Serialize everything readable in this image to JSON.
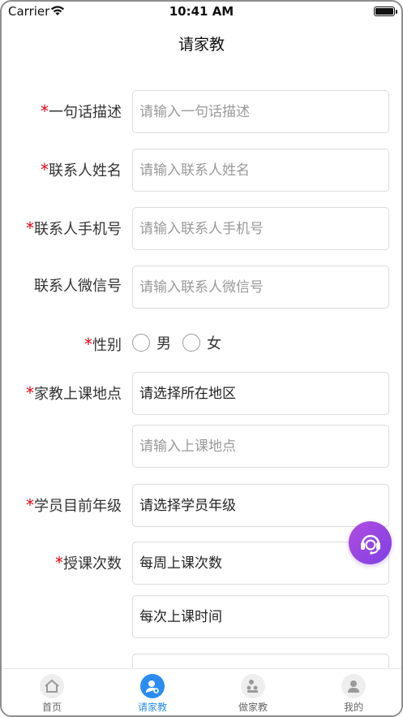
{
  "status_bar": {
    "carrier": "Carrier",
    "time": "10:41 AM",
    "icons": [
      "wifi-icon",
      "battery-icon"
    ]
  },
  "nav": {
    "title": "请家教"
  },
  "form": {
    "required_mark": "*",
    "summary": {
      "label": "一句话描述",
      "required": true,
      "placeholder": "请输入一句话描述",
      "value": ""
    },
    "contact_name": {
      "label": "联系人姓名",
      "required": true,
      "placeholder": "请输入联系人姓名",
      "value": ""
    },
    "contact_phone": {
      "label": "联系人手机号",
      "required": true,
      "placeholder": "请输入联系人手机号",
      "value": ""
    },
    "contact_wechat": {
      "label": "联系人微信号",
      "required": false,
      "placeholder": "请输入联系人微信号",
      "value": ""
    },
    "gender": {
      "label": "性别",
      "required": true,
      "options": [
        "男",
        "女"
      ],
      "selected": null
    },
    "location": {
      "label": "家教上课地点",
      "required": true,
      "region_select": "请选择所在地区",
      "address_placeholder": "请输入上课地点"
    },
    "grade": {
      "label": "学员目前年级",
      "required": true,
      "select": "请选择学员年级"
    },
    "sessions": {
      "label": "授课次数",
      "required": true,
      "per_week_select": "每周上课次数",
      "duration_select": "每次上课时间"
    }
  },
  "fab": {
    "icon": "customer-service-icon"
  },
  "tab_bar": {
    "active_color": "#2b8df2",
    "items": [
      {
        "label": "首页",
        "icon": "home-icon",
        "active": false
      },
      {
        "label": "请家教",
        "icon": "search-person-icon",
        "active": true
      },
      {
        "label": "做家教",
        "icon": "teach-icon",
        "active": false
      },
      {
        "label": "我的",
        "icon": "profile-icon",
        "active": false
      }
    ]
  }
}
